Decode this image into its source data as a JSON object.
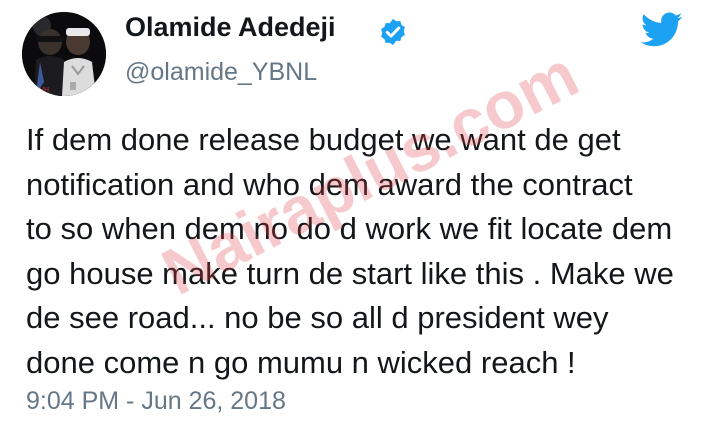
{
  "profile": {
    "display_name": "Olamide Adedeji",
    "handle": "@olamide_YBNL",
    "verified": true
  },
  "icons": {
    "verified": "verified-badge-icon",
    "brand": "twitter-bird-icon"
  },
  "tweet": {
    "lines": [
      "If dem done release budget we want de get",
      "notification and who dem award the contract",
      "to so when dem no do d work we fit locate dem",
      "go house make turn de start like this . Make we",
      "de see road... no be so all d president wey",
      "done come n go mumu n wicked reach !"
    ],
    "timestamp": "9:04 PM - Jun 26, 2018"
  },
  "watermark": {
    "text": "Nairaplus.com"
  },
  "colors": {
    "text": "#14171a",
    "secondary": "#657786",
    "twitter_blue": "#1da1f2",
    "watermark": "#e0404c"
  }
}
